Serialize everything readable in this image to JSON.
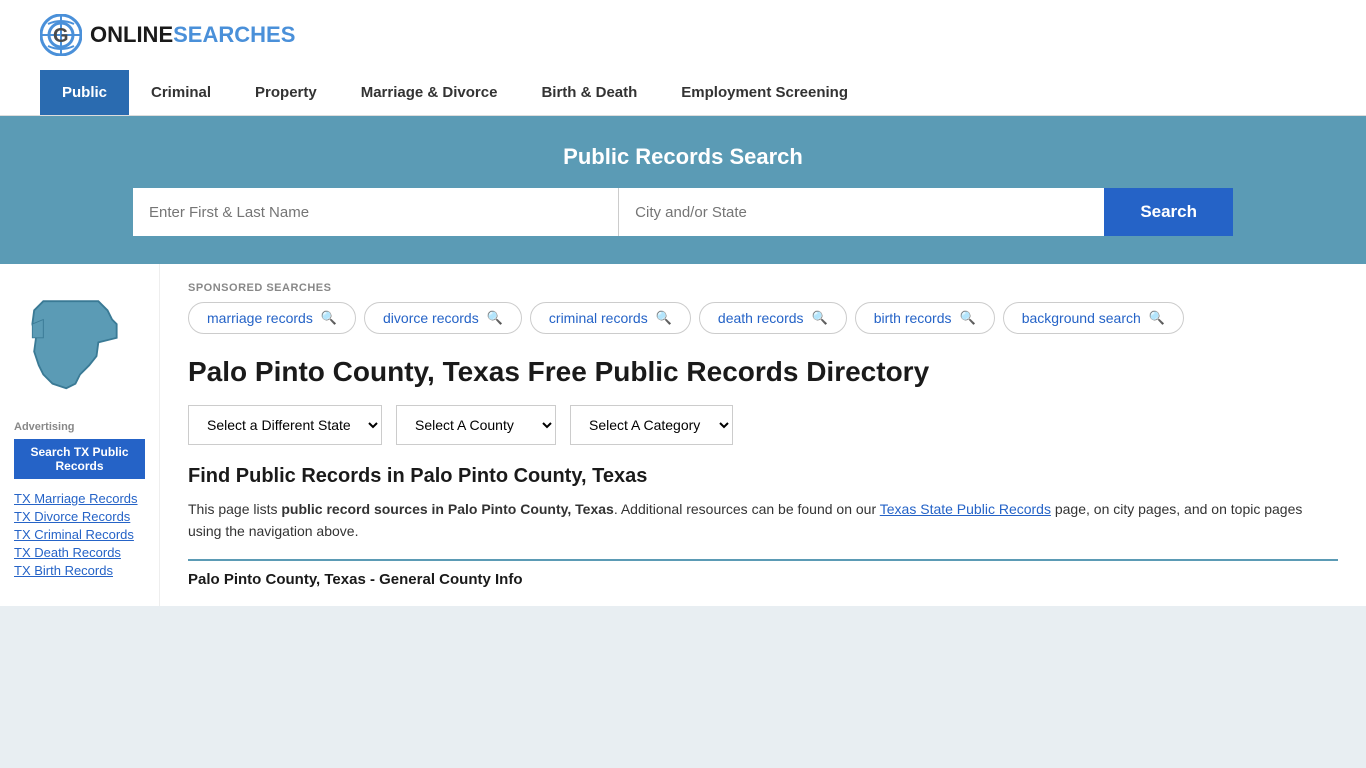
{
  "site": {
    "logo_text_online": "ONLINE",
    "logo_text_searches": "SEARCHES"
  },
  "nav": {
    "items": [
      {
        "label": "Public",
        "active": true
      },
      {
        "label": "Criminal",
        "active": false
      },
      {
        "label": "Property",
        "active": false
      },
      {
        "label": "Marriage & Divorce",
        "active": false
      },
      {
        "label": "Birth & Death",
        "active": false
      },
      {
        "label": "Employment Screening",
        "active": false
      }
    ]
  },
  "search_banner": {
    "title": "Public Records Search",
    "name_placeholder": "Enter First & Last Name",
    "location_placeholder": "City and/or State",
    "search_button": "Search"
  },
  "sponsored": {
    "label": "SPONSORED SEARCHES",
    "tags": [
      "marriage records",
      "divorce records",
      "criminal records",
      "death records",
      "birth records",
      "background search"
    ]
  },
  "page": {
    "title": "Palo Pinto County, Texas Free Public Records Directory",
    "dropdowns": {
      "state": "Select a Different State",
      "county": "Select A County",
      "category": "Select A Category"
    },
    "find_title": "Find Public Records in Palo Pinto County, Texas",
    "find_desc_part1": "This page lists ",
    "find_desc_bold": "public record sources in Palo Pinto County, Texas",
    "find_desc_part2": ". Additional resources can be found on our ",
    "find_desc_link": "Texas State Public Records",
    "find_desc_part3": " page, on city pages, and on topic pages using the navigation above.",
    "county_info_header": "Palo Pinto County, Texas - General County Info"
  },
  "sidebar": {
    "ad_label": "Advertising",
    "ad_button": "Search TX Public Records",
    "links": [
      "TX Marriage Records",
      "TX Divorce Records",
      "TX Criminal Records",
      "TX Death Records",
      "TX Birth Records"
    ]
  }
}
